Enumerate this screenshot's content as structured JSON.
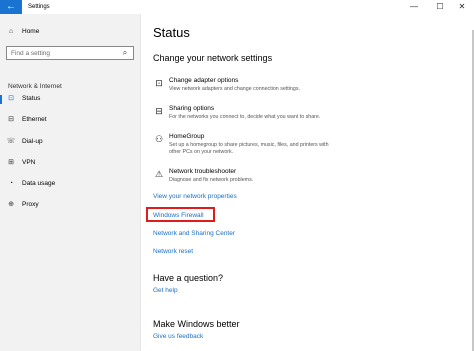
{
  "window": {
    "title": "Settings",
    "back_glyph": "←",
    "minimize_glyph": "—",
    "maximize_glyph": "☐",
    "close_glyph": "✕"
  },
  "colors": {
    "accent": "#1a73d1",
    "link": "#1a6fc4",
    "highlight": "#e01b1b"
  },
  "sidebar": {
    "home": {
      "label": "Home",
      "icon": "home-icon",
      "glyph": "⌂"
    },
    "search": {
      "placeholder": "Find a setting",
      "value": "",
      "icon": "search-icon",
      "glyph": "⌕"
    },
    "section_label": "Network & Internet",
    "items": [
      {
        "label": "Status",
        "icon": "status-icon",
        "glyph": "⊡",
        "active": true
      },
      {
        "label": "Ethernet",
        "icon": "ethernet-icon",
        "glyph": "⊟",
        "active": false
      },
      {
        "label": "Dial-up",
        "icon": "dialup-icon",
        "glyph": "☏",
        "active": false
      },
      {
        "label": "VPN",
        "icon": "vpn-icon",
        "glyph": "⊞",
        "active": false
      },
      {
        "label": "Data usage",
        "icon": "data-usage-icon",
        "glyph": "◔",
        "active": false
      },
      {
        "label": "Proxy",
        "icon": "proxy-icon",
        "glyph": "⊕",
        "active": false
      }
    ]
  },
  "main": {
    "title": "Status",
    "subtitle": "Change your network settings",
    "options": [
      {
        "title": "Change adapter options",
        "desc": "View network adapters and change connection settings.",
        "icon": "adapter-icon",
        "glyph": "⊡"
      },
      {
        "title": "Sharing options",
        "desc": "For the networks you connect to, decide what you want to share.",
        "icon": "sharing-icon",
        "glyph": "⊟"
      },
      {
        "title": "HomeGroup",
        "desc": "Set up a homegroup to share pictures, music, files, and printers with other PCs on your network.",
        "icon": "homegroup-icon",
        "glyph": "⚇"
      },
      {
        "title": "Network troubleshooter",
        "desc": "Diagnose and fix network problems.",
        "icon": "troubleshooter-icon",
        "glyph": "⚠"
      }
    ],
    "links": {
      "view_properties": "View your network properties",
      "windows_firewall": "Windows Firewall",
      "sharing_center": "Network and Sharing Center",
      "network_reset": "Network reset"
    },
    "question": {
      "heading": "Have a question?",
      "link": "Get help"
    },
    "better": {
      "heading": "Make Windows better",
      "link": "Give us feedback"
    }
  }
}
